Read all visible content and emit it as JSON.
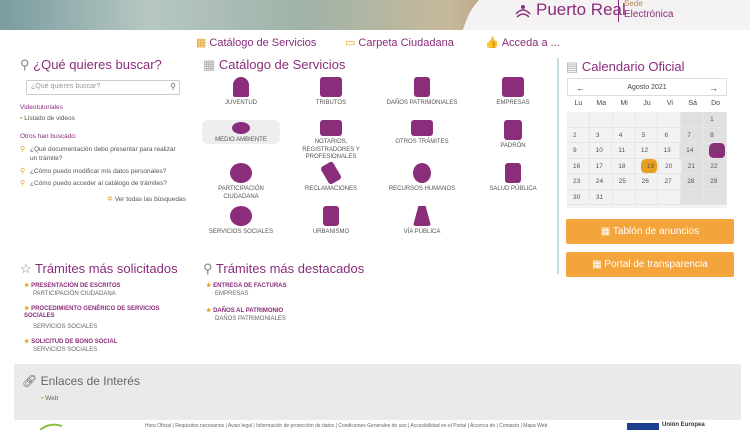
{
  "header": {
    "logo_name": "Puerto Real",
    "logo_sub_top": "Sede",
    "logo_sub": "Electrónica"
  },
  "nav": {
    "catalogo": "Catálogo de Servicios",
    "carpeta": "Carpeta Ciudadana",
    "acceda": "Acceda a ..."
  },
  "search": {
    "title": "¿Qué quieres buscar?",
    "placeholder": "¿Qué quieres buscar?",
    "videotutoriales": "Videotutoriales",
    "listado_videos": "Listado de videos",
    "otros_title": "Otros han buscado:",
    "q1": "¿Qué documentación debo presentar para realizar un trámite?",
    "q2": "¿Cómo puedo modificar mis datos personales?",
    "q3": "¿Cómo puedo acceder al catálogo de trámites?",
    "ver_todas": "Ver todas las búsquedas"
  },
  "catalog": {
    "title": "Catálogo de Servicios",
    "items": [
      {
        "label": "JUVENTUD",
        "icon": "person-icon"
      },
      {
        "label": "TRIBUTOS",
        "icon": "briefcase-icon"
      },
      {
        "label": "DAÑOS PATRIMONIALES",
        "icon": "document-icon"
      },
      {
        "label": "EMPRESAS",
        "icon": "box-icon"
      },
      {
        "label": "MEDIO AMBIENTE",
        "icon": "leaf-icon"
      },
      {
        "label": "NOTARIOS, REGISTRADORES Y PROFESIONALES",
        "icon": "folder-icon"
      },
      {
        "label": "OTROS TRÁMITES",
        "icon": "list-icon"
      },
      {
        "label": "PADRÓN",
        "icon": "book-icon"
      },
      {
        "label": "PARTICIPACIÓN CIUDADANA",
        "icon": "people-icon"
      },
      {
        "label": "RECLAMACIONES",
        "icon": "gavel-icon"
      },
      {
        "label": "RECURSOS HUMANOS",
        "icon": "user-icon"
      },
      {
        "label": "SALUD PÚBLICA",
        "icon": "hospital-icon"
      },
      {
        "label": "SERVICIOS SOCIALES",
        "icon": "heart-icon"
      },
      {
        "label": "URBANISMO",
        "icon": "building-icon"
      },
      {
        "label": "VÍA PÚBLICA",
        "icon": "road-icon"
      }
    ]
  },
  "calendar": {
    "title": "Calendario Oficial",
    "month": "Agosto 2021",
    "dow": [
      "Lu",
      "Ma",
      "Mi",
      "Ju",
      "Vi",
      "Sá",
      "Do"
    ],
    "weeks": [
      [
        "",
        "",
        "",
        "",
        "",
        "",
        "1"
      ],
      [
        "2",
        "3",
        "4",
        "5",
        "6",
        "7",
        "8"
      ],
      [
        "9",
        "10",
        "11",
        "12",
        "13",
        "14",
        "15"
      ],
      [
        "16",
        "17",
        "18",
        "19",
        "20",
        "21",
        "22"
      ],
      [
        "23",
        "24",
        "25",
        "26",
        "27",
        "28",
        "29"
      ],
      [
        "30",
        "31",
        "",
        "",
        "",
        "",
        ""
      ]
    ],
    "today": "19",
    "event_day": "15"
  },
  "buttons": {
    "tablon": "Tablón de anuncios",
    "portal": "Portal de transparencia"
  },
  "solicitados": {
    "title": "Trámites más solicitados",
    "items": [
      {
        "title": "PRESENTACIÓN DE ESCRITOS",
        "sub": "PARTICIPACIÓN CIUDADANA"
      },
      {
        "title": "PROCEDIMIENTO GENÉRICO DE SERVICIOS SOCIALES",
        "sub": "SERVICIOS SOCIALES"
      },
      {
        "title": "SOLICITUD DE BONO SOCIAL",
        "sub": "SERVICIOS SOCIALES"
      }
    ]
  },
  "destacados": {
    "title": "Trámites más destacados",
    "items": [
      {
        "title": "ENTREGA DE FACTURAS",
        "sub": "EMPRESAS"
      },
      {
        "title": "DAÑOS AL PATRIMONIO",
        "sub": "DAÑOS PATRIMONIALES"
      }
    ]
  },
  "enlaces": {
    "title": "Enlaces de Interés",
    "web": "Web"
  },
  "footer": {
    "links": "Hora Oficial | Requisitos necesarios | Aviso legal | Información de protección de datos | Condiciones Generales de uso | Accesibilidad en el Portal | Accerca de | Contacto | Mapa Web",
    "eu": "Unión Europea"
  },
  "colors": {
    "brand": "#8a2d7a",
    "accent": "#f3a43b"
  }
}
